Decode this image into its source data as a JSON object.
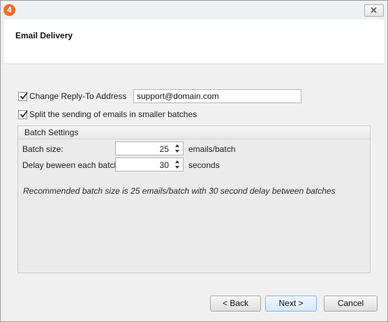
{
  "window": {
    "app_icon_text": "4"
  },
  "header": {
    "title": "Email Delivery"
  },
  "reply_to": {
    "label": "Change Reply-To Address",
    "checked": true,
    "value": "support@domain.com"
  },
  "split_batches": {
    "label": "Split the sending of emails in smaller batches",
    "checked": true
  },
  "batch_settings": {
    "title": "Batch Settings",
    "batch_size_label": "Batch size:",
    "batch_size_value": "25",
    "batch_size_unit": "emails/batch",
    "delay_label": "Delay beween each batch:",
    "delay_value": "30",
    "delay_unit": "seconds",
    "recommendation": "Recommended batch size is 25 emails/batch with 30 second delay between batches"
  },
  "buttons": {
    "back": "< Back",
    "next": "Next >",
    "cancel": "Cancel"
  }
}
